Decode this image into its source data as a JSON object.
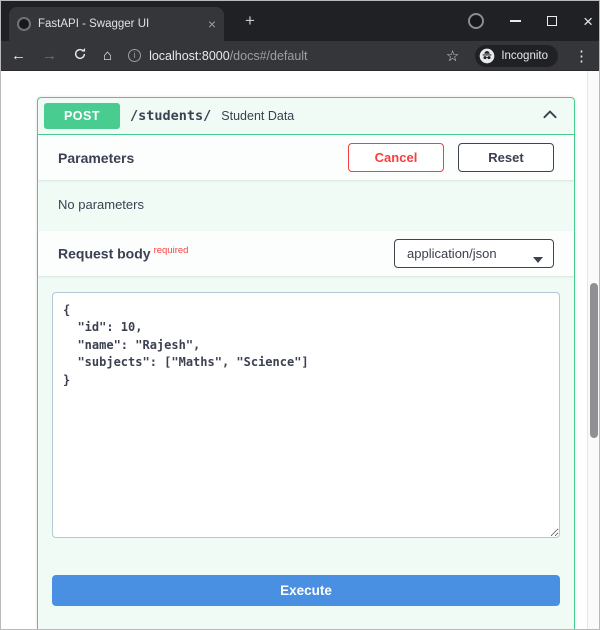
{
  "browser": {
    "tab_title": "FastAPI - Swagger UI",
    "new_tab_label": "+",
    "url_host": "localhost:8000",
    "url_path": "/docs#/default",
    "incognito_label": "Incognito"
  },
  "opblock": {
    "method": "POST",
    "path": "/students/",
    "summary": "Student Data"
  },
  "parameters_section": {
    "heading": "Parameters",
    "cancel_label": "Cancel",
    "reset_label": "Reset",
    "empty_text": "No parameters"
  },
  "request_body_section": {
    "heading": "Request body",
    "required_label": "required",
    "media_type": "application/json",
    "body_value": "{\n  \"id\": 10,\n  \"name\": \"Rajesh\",\n  \"subjects\": [\"Maths\", \"Science\"]\n}"
  },
  "execute_label": "Execute",
  "colors": {
    "method_green": "#49cc90",
    "execute_blue": "#4990e2",
    "cancel_red": "#f93e3e"
  }
}
